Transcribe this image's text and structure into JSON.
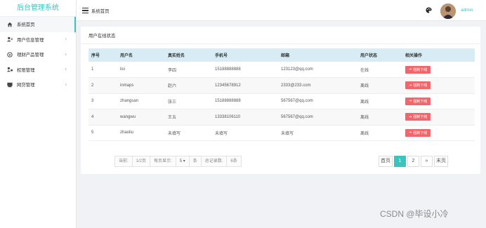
{
  "sidebar": {
    "brand": "后台管理系统",
    "items": [
      {
        "label": "系统首页",
        "icon": "home-icon",
        "active": true
      },
      {
        "label": "用户信息管理",
        "icon": "users-icon",
        "arrow": "›"
      },
      {
        "label": "理财产品管理",
        "icon": "coin-icon",
        "arrow": "›"
      },
      {
        "label": "权限管理",
        "icon": "permission-icon",
        "arrow": "›"
      },
      {
        "label": "网贷管理",
        "icon": "loan-icon",
        "arrow": "›"
      }
    ]
  },
  "header": {
    "breadcrumb": "系统首页",
    "username": "admin"
  },
  "main": {
    "title": "用户在线状态",
    "columns": [
      "序号",
      "用户名",
      "真实姓名",
      "手机号",
      "邮箱",
      "用户状态",
      "相关操作"
    ],
    "rows": [
      [
        "1",
        "lisi",
        "李四",
        "15188888888",
        "123123@qq.com",
        "在线"
      ],
      [
        "2",
        "inmaps",
        "赵六",
        "12345678912",
        "2333@233.com",
        "离线"
      ],
      [
        "3",
        "zhangsan",
        "张三",
        "15188888888",
        "567567@qq.com",
        "离线"
      ],
      [
        "4",
        "wangwu",
        "王五",
        "13338106110",
        "567567@qq.com",
        "离线"
      ],
      [
        "5",
        "zhaoliu",
        "未填写",
        "未填写",
        "未填写",
        "离线"
      ]
    ],
    "action_label": "强制下线"
  },
  "pagination": {
    "current_label": "当前:",
    "page_info": "1/2页",
    "per_page_label": "每页显示:",
    "per_page_value": "5",
    "per_page_unit": "条",
    "total_label": "总记录数:",
    "total_value": "6条",
    "first": "首页",
    "pages": [
      "1",
      "2"
    ],
    "next": "»",
    "last": "末页"
  },
  "watermark": "CSDN @毕设小冷",
  "colors": {
    "accent": "#3ac4bd",
    "danger": "#f1666a",
    "table_header": "#d8ecf6"
  }
}
